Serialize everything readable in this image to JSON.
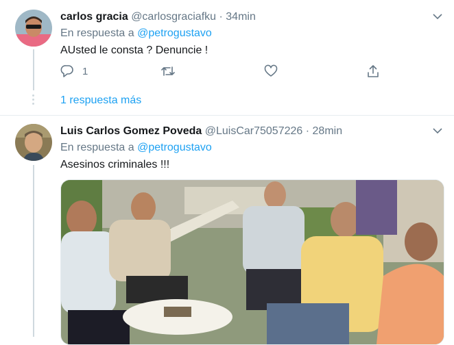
{
  "tweets": [
    {
      "name": "carlos gracia",
      "handle": "@carlosgraciafku",
      "separator": "·",
      "time": "34min",
      "reply_prefix": "En respuesta a",
      "reply_mention": "@petrogustavo",
      "text": "AUsted le consta ? Denuncie !",
      "reply_count": "1",
      "avatar_icon": "sunglasses-man-avatar"
    },
    {
      "name": "Luis Carlos Gomez Poveda",
      "handle": "@LuisCar75057226",
      "separator": "·",
      "time": "28min",
      "reply_prefix": "En respuesta a",
      "reply_mention": "@petrogustavo",
      "text": "Asesinos criminales !!!",
      "avatar_icon": "man-portrait-avatar",
      "media": "photo-of-men-seated-around-table"
    }
  ],
  "more_replies": "1 respuesta más",
  "colors": {
    "link": "#1da1f2",
    "muted": "#657786",
    "text": "#14171a",
    "divider": "#e6ecf0"
  }
}
